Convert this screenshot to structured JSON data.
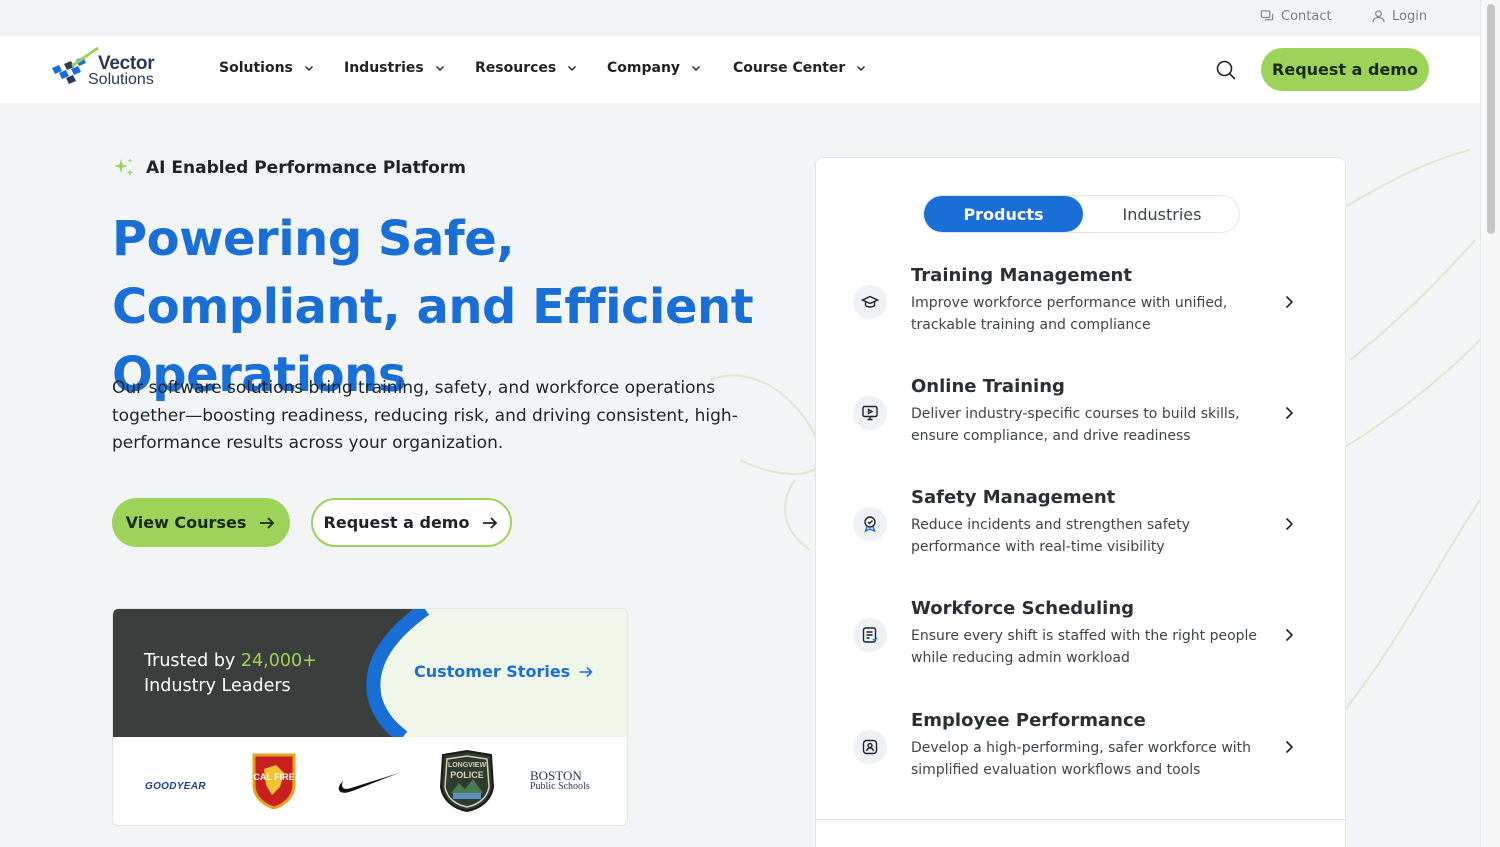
{
  "topbar": {
    "contact": "Contact",
    "login": "Login"
  },
  "brand": {
    "name_line1": "Vector",
    "name_line2": "Solutions",
    "color": "#2b3a55"
  },
  "nav": {
    "items": [
      {
        "label": "Solutions"
      },
      {
        "label": "Industries"
      },
      {
        "label": "Resources"
      },
      {
        "label": "Company"
      },
      {
        "label": "Course Center"
      }
    ],
    "cta": "Request a demo"
  },
  "hero": {
    "eyebrow": "AI Enabled Performance Platform",
    "title": "Powering Safe, Compliant, and Efficient Operations",
    "description": "Our software solutions bring training, safety, and workforce operations together—boosting readiness, reducing risk, and driving consistent, high-performance results across your organization.",
    "primary_button": "View Courses",
    "secondary_button": "Request a demo"
  },
  "trust": {
    "prefix": "Trusted by ",
    "count": "24,000+",
    "suffix": "Industry Leaders",
    "link": "Customer Stories",
    "logos": {
      "goodyear": "GOODYEAR",
      "calfire": "CAL FIRE",
      "longview": "LONGVIEW",
      "police": "POLICE",
      "boston1": "BOSTON",
      "boston2": "Public Schools"
    }
  },
  "panel": {
    "tabs": {
      "active": "Products",
      "inactive": "Industries"
    },
    "products": [
      {
        "title": "Training Management",
        "desc": "Improve workforce performance with unified, trackable training and compliance",
        "icon": "graduation-cap-icon"
      },
      {
        "title": "Online Training",
        "desc": "Deliver industry-specific courses to build skills, ensure compliance, and drive readiness",
        "icon": "video-lesson-icon"
      },
      {
        "title": "Safety Management",
        "desc": "Reduce incidents and strengthen safety performance with real-time visibility",
        "icon": "safety-badge-icon"
      },
      {
        "title": "Workforce Scheduling",
        "desc": "Ensure every shift is staffed with the right people while reducing admin workload",
        "icon": "schedule-list-icon"
      },
      {
        "title": "Employee Performance",
        "desc": "Develop a high-performing, safer workforce with simplified evaluation workflows and tools",
        "icon": "employee-profile-icon"
      }
    ]
  },
  "colors": {
    "accent_blue": "#1a6fd6",
    "accent_green": "#9ed35a",
    "dark_band": "#3a3f3d"
  }
}
